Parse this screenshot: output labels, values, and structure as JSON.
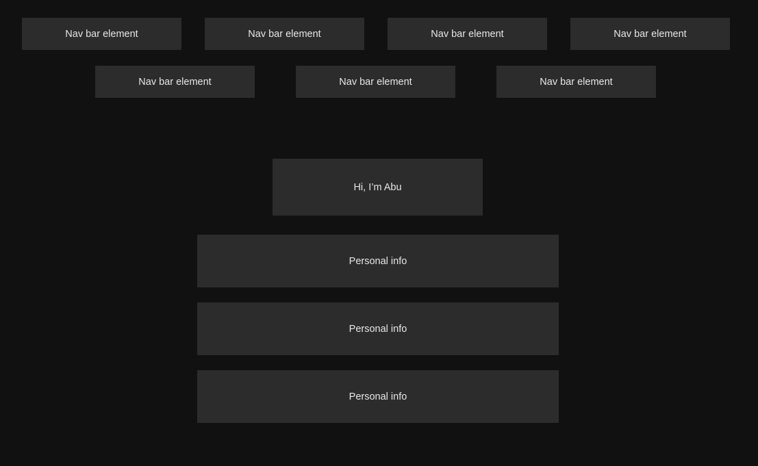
{
  "nav": {
    "row1": [
      {
        "label": "Nav bar element"
      },
      {
        "label": "Nav bar element"
      },
      {
        "label": "Nav bar element"
      },
      {
        "label": "Nav bar element"
      }
    ],
    "row2": [
      {
        "label": "Nav bar element"
      },
      {
        "label": "Nav bar element"
      },
      {
        "label": "Nav bar element"
      }
    ]
  },
  "hero": {
    "greeting": "Hi, I’m Abu"
  },
  "info_sections": [
    {
      "label": "Personal info"
    },
    {
      "label": "Personal info"
    },
    {
      "label": "Personal info"
    }
  ],
  "colors": {
    "background": "#111111",
    "panel": "#2c2c2c",
    "text": "#e6e6e6"
  }
}
